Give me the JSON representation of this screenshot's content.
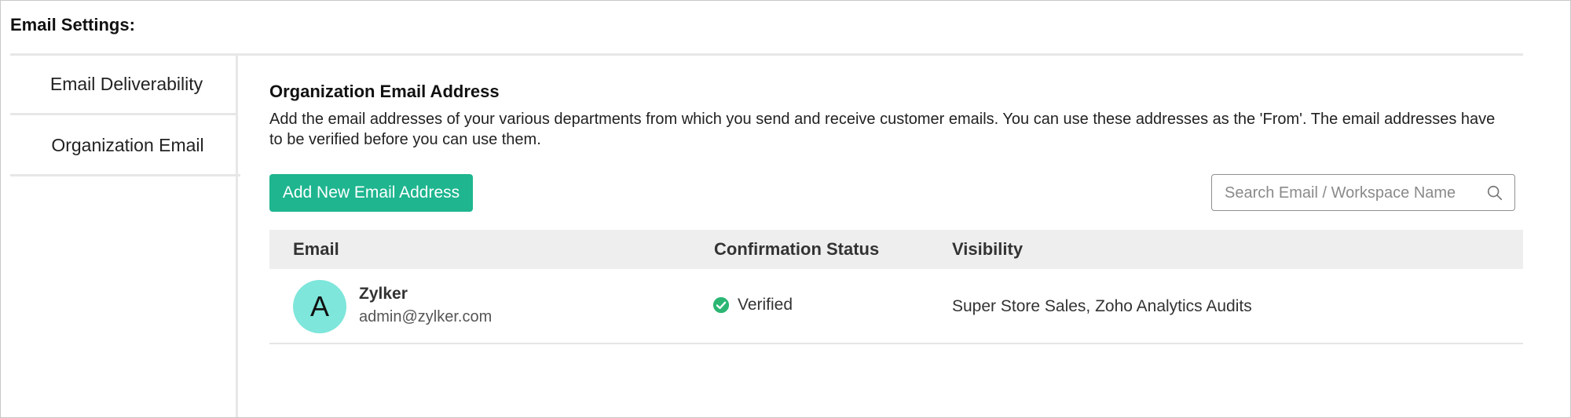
{
  "page": {
    "title": "Email Settings:"
  },
  "sidebar": {
    "items": [
      {
        "label": "Email Deliverability",
        "active": false
      },
      {
        "label": "Organization Email",
        "active": true
      }
    ]
  },
  "main": {
    "section_title": "Organization Email Address",
    "description": "Add the email addresses of your various departments from which you send and receive customer emails. You can use these addresses as the 'From'. The email addresses have to be verified before you can use them.",
    "add_button_label": "Add New Email Address",
    "search": {
      "placeholder": "Search Email / Workspace Name",
      "value": "",
      "icon": "search-icon"
    },
    "table": {
      "columns": [
        "Email",
        "Confirmation Status",
        "Visibility"
      ],
      "rows": [
        {
          "avatar_letter": "A",
          "name": "Zylker",
          "email": "admin@zylker.com",
          "status": "Verified",
          "status_icon": "check-circle-icon",
          "visibility": "Super Store Sales, Zoho Analytics Audits"
        }
      ]
    }
  },
  "colors": {
    "accent": "#1eb58f",
    "avatar_bg": "#7ee6db",
    "verified": "#2bb673",
    "header_bg": "#eeeeee"
  }
}
